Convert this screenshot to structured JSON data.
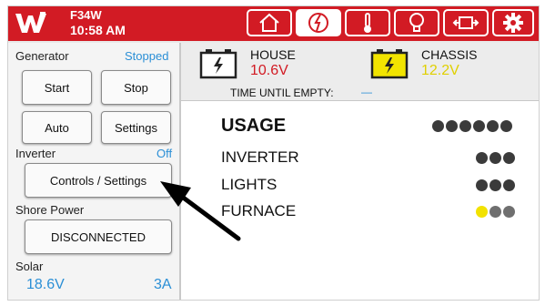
{
  "header": {
    "model": "F34W",
    "time": "10:58 AM",
    "colors": {
      "brand": "#d21b24"
    },
    "tabs": [
      {
        "icon": "home-icon"
      },
      {
        "icon": "power-icon",
        "active": true
      },
      {
        "icon": "thermometer-icon"
      },
      {
        "icon": "lightbulb-icon"
      },
      {
        "icon": "slide-out-icon"
      },
      {
        "icon": "gear-icon"
      }
    ]
  },
  "generator": {
    "label": "Generator",
    "status": "Stopped",
    "buttons": {
      "start": "Start",
      "stop": "Stop",
      "auto": "Auto",
      "settings": "Settings"
    }
  },
  "inverter": {
    "label": "Inverter",
    "status": "Off",
    "button": "Controls / Settings"
  },
  "shore_power": {
    "label": "Shore Power",
    "button": "DISCONNECTED"
  },
  "solar": {
    "label": "Solar",
    "voltage": "18.6V",
    "current": "3A"
  },
  "batteries": {
    "house": {
      "name": "HOUSE",
      "voltage": "10.6V",
      "color": "#d21b24"
    },
    "chassis": {
      "name": "CHASSIS",
      "voltage": "12.2V",
      "color": "#e8d800"
    },
    "time_until_empty_label": "TIME UNTIL EMPTY:",
    "time_until_empty_value": "—"
  },
  "usage": {
    "title": "USAGE",
    "title_dots": 6,
    "rows": [
      {
        "label": "INVERTER",
        "dots": [
          "dark",
          "dark",
          "dark"
        ]
      },
      {
        "label": "LIGHTS",
        "dots": [
          "dark",
          "dark",
          "dark"
        ]
      },
      {
        "label": "FURNACE",
        "dots": [
          "yellow",
          "gray",
          "gray"
        ]
      }
    ]
  }
}
